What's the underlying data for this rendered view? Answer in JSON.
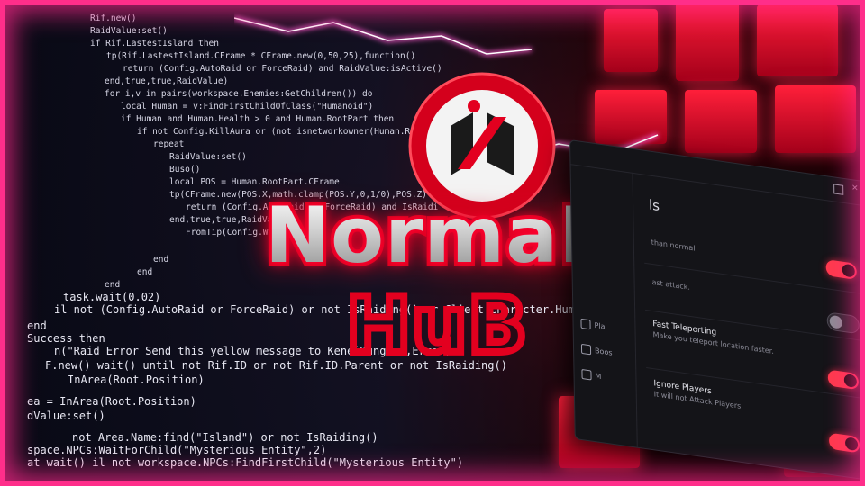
{
  "code": {
    "lines": [
      "Rif.new()",
      "RaidValue:set()",
      "if Rif.LastestIsland then",
      "tp(Rif.LastestIsland.CFrame * CFrame.new(0,50,25),function()",
      "return (Config.AutoRaid or ForceRaid) and RaidValue:isActive()",
      "end,true,true,RaidValue)",
      "for i,v in pairs(workspace.Enemies:GetChildren()) do",
      "local Human = v:FindFirstChildOfClass(\"Humanoid\")",
      "if Human and Human.Health > 0 and Human.RootPart then",
      "if not Config.KillAura or (not isnetworkowner(Human.RootPart)",
      "repeat",
      "RaidValue:set()",
      "Buso()",
      "local POS = Human.RootPart.CFrame",
      "tp(CFrame.new(POS.X,math.clamp(POS.Y,0,1/0),POS.Z) *",
      "return (Config.AutoRaid or ForceRaid) and IsRaidi",
      "end,true,true,RaidValue)",
      "FromTip(Config.Weapon)",
      "end",
      "end",
      "end",
      "task.wait(0.02)",
      "il not (Config.AutoRaid or ForceRaid) or not IsRaiding() or Client.Character.Humanoid.Health <= 0 or not RaidValue:isActive",
      "end",
      "Success then",
      "n(\"Raid Error Send this yellow message to KeneiKung\\n\",Error)",
      "F.new() wait() until not Rif.ID or not Rif.ID.Parent or not IsRaiding()",
      "InArea(Root.Position)",
      "ea = InArea(Root.Position)",
      "dValue:set()",
      "not Area.Name:find(\"Island\") or not IsRaiding()",
      "space.NPCs:WaitForChild(\"Mysterious Entity\",2)",
      "at wait() il not workspace.NPCs:FindFirstChild(\"Mysterious Entity\")"
    ]
  },
  "title": "NormaL HuB",
  "window": {
    "section_title": "ls",
    "sidebar": [
      {
        "label": "Pla",
        "icon": "player-icon"
      },
      {
        "label": "Boos",
        "icon": "boost-icon"
      },
      {
        "label": "M",
        "icon": "misc-icon"
      }
    ],
    "settings": [
      {
        "title": "",
        "desc": "than normal",
        "state": "on"
      },
      {
        "title": "",
        "desc": "ast attack.",
        "state": "off"
      },
      {
        "title": "Fast Teleporting",
        "desc": "Make you teleport location faster.",
        "state": "on"
      },
      {
        "title": "Ignore Players",
        "desc": "It will not Attack Players",
        "state": "on"
      }
    ]
  },
  "colors": {
    "accent": "#ff3a4e",
    "frame": "#ff2e8a",
    "title_glow": "#e3001f"
  }
}
